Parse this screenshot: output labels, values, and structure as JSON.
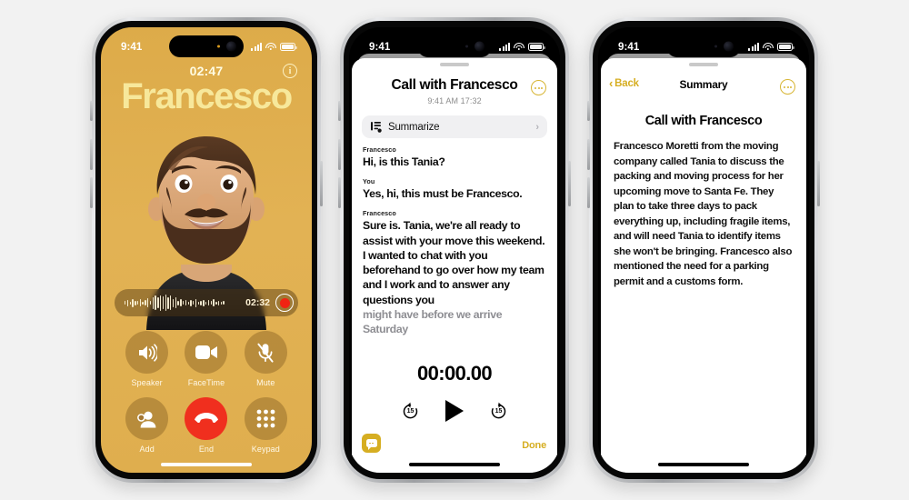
{
  "page": {
    "background": "#f2f2f2"
  },
  "phone1": {
    "name": "in-call-screen",
    "status": {
      "time": "9:41"
    },
    "call": {
      "timer": "02:47",
      "contact_name": "Francesco",
      "info_glyph": "i",
      "recording": {
        "time": "02:32"
      },
      "controls": [
        {
          "label": "Speaker",
          "icon": "speaker-icon"
        },
        {
          "label": "FaceTime",
          "icon": "video-camera-icon"
        },
        {
          "label": "Mute",
          "icon": "microphone-muted-icon"
        },
        {
          "label": "Add",
          "icon": "add-call-icon"
        },
        {
          "label": "End",
          "icon": "end-call-icon"
        },
        {
          "label": "Keypad",
          "icon": "keypad-icon"
        }
      ],
      "accent_background": "#e0ae4b",
      "name_color": "#f7e89b",
      "end_color": "#f02f1e"
    }
  },
  "phone2": {
    "name": "call-transcript-screen",
    "status": {
      "time": "9:41"
    },
    "header": {
      "title": "Call with Francesco",
      "subtitle": "9:41 AM  17:32",
      "more_icon": "more-ellipsis-icon"
    },
    "summarize": {
      "label": "Summarize",
      "icon": "document-summary-icon",
      "chevron": "›"
    },
    "transcript": [
      {
        "speaker": "Francesco",
        "text": "Hi, is this Tania?",
        "faded": false
      },
      {
        "speaker": "You",
        "text": "Yes, hi, this must be Francesco.",
        "faded": false
      },
      {
        "speaker": "Francesco",
        "text": "Sure is. Tania, we're all ready to assist with your move this weekend. I wanted to chat with you beforehand to go over how my team and I work and to answer any questions you",
        "faded": false
      },
      {
        "speaker": "",
        "text": "might have before we arrive Saturday",
        "faded": true
      }
    ],
    "player": {
      "elapsed": "00:00.00",
      "back_label": "15",
      "forward_label": "15",
      "play_icon": "play-icon",
      "skip_back_icon": "skip-back-15-icon",
      "skip_forward_icon": "skip-forward-15-icon"
    },
    "chat_fab": {
      "icon": "chat-bubble-icon"
    },
    "done_label": "Done",
    "accent_color": "#d6ae22"
  },
  "phone3": {
    "name": "summary-screen",
    "status": {
      "time": "9:41"
    },
    "nav": {
      "back_label": "Back",
      "back_icon": "chevron-left-icon",
      "title": "Summary",
      "more_icon": "more-ellipsis-icon"
    },
    "heading": "Call with Francesco",
    "body": "Francesco Moretti from the moving company called Tania to discuss the packing and moving process for her upcoming move to Santa Fe. They plan to take three days to pack everything up, including fragile items, and will need Tania to identify items she won't be bringing. Francesco also mentioned the need for a parking permit and a customs form.",
    "accent_color": "#d6ae22"
  }
}
